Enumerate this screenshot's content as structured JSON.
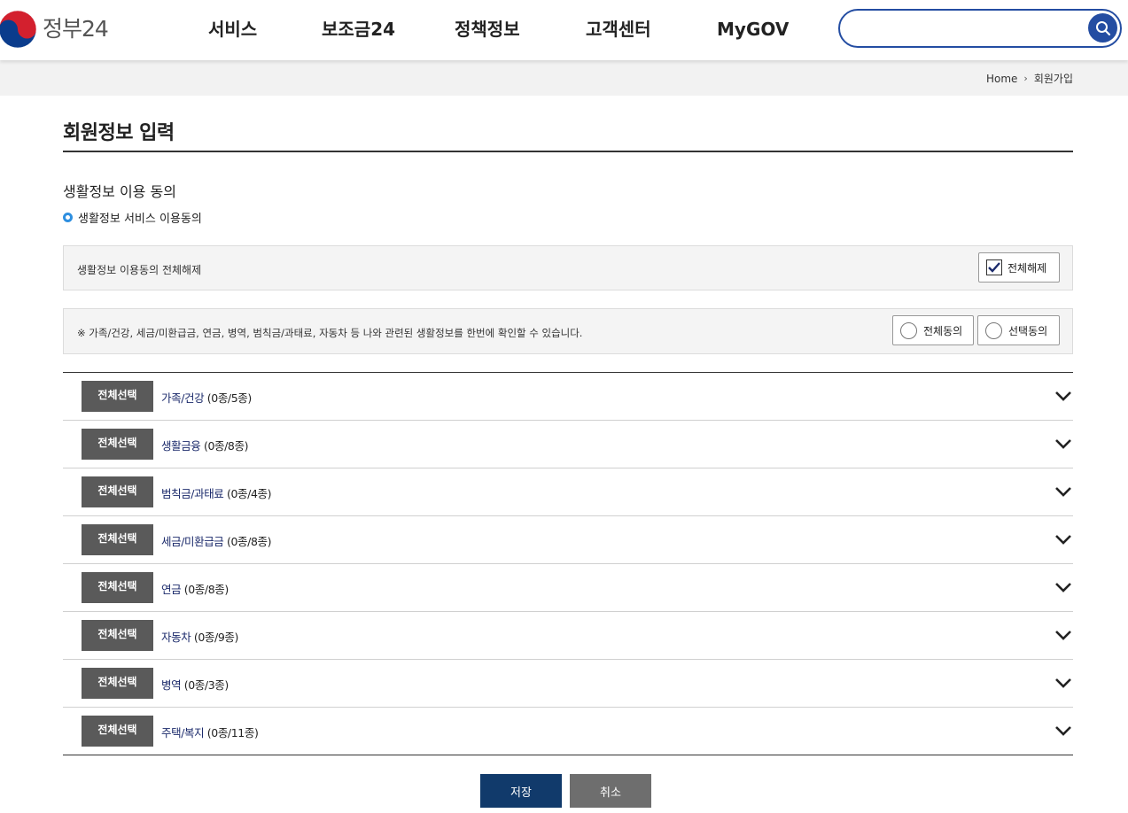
{
  "header": {
    "logo_text": "정부24",
    "nav": [
      "서비스",
      "보조금24",
      "정책정보",
      "고객센터",
      "MyGOV"
    ],
    "search_value": ""
  },
  "breadcrumb": {
    "home": "Home",
    "current": "회원가입"
  },
  "page": {
    "title": "회원정보 입력",
    "section_title": "생활정보 이용 동의",
    "sub_title": "생활정보 서비스 이용동의"
  },
  "consent": {
    "release_all_text": "생활정보 이용동의 전체해제",
    "release_all_button": "전체해제",
    "release_all_checked": true,
    "info_text": "※ 가족/건강, 세금/미환급금, 연금, 병역, 범칙금/과태료, 자동차 등 나와 관련된 생활정보를 한번에 확인할 수 있습니다.",
    "agree_all_label": "전체동의",
    "agree_select_label": "선택동의"
  },
  "categories": [
    {
      "select_label": "전체선택",
      "name": "가족/건강",
      "count": "(0종/5종)"
    },
    {
      "select_label": "전체선택",
      "name": "생활금융",
      "count": "(0종/8종)"
    },
    {
      "select_label": "전체선택",
      "name": "범칙금/과태료",
      "count": "(0종/4종)"
    },
    {
      "select_label": "전체선택",
      "name": "세금/미환급금",
      "count": "(0종/8종)"
    },
    {
      "select_label": "전체선택",
      "name": "연금",
      "count": "(0종/8종)"
    },
    {
      "select_label": "전체선택",
      "name": "자동차",
      "count": "(0종/9종)"
    },
    {
      "select_label": "전체선택",
      "name": "병역",
      "count": "(0종/3종)"
    },
    {
      "select_label": "전체선택",
      "name": "주택/복지",
      "count": "(0종/11종)"
    }
  ],
  "actions": {
    "save": "저장",
    "cancel": "취소"
  },
  "colors": {
    "brand_blue": "#244da2",
    "save_button": "#113a6b",
    "select_button": "#5a5a5a",
    "bullet": "#2e8fe0"
  }
}
